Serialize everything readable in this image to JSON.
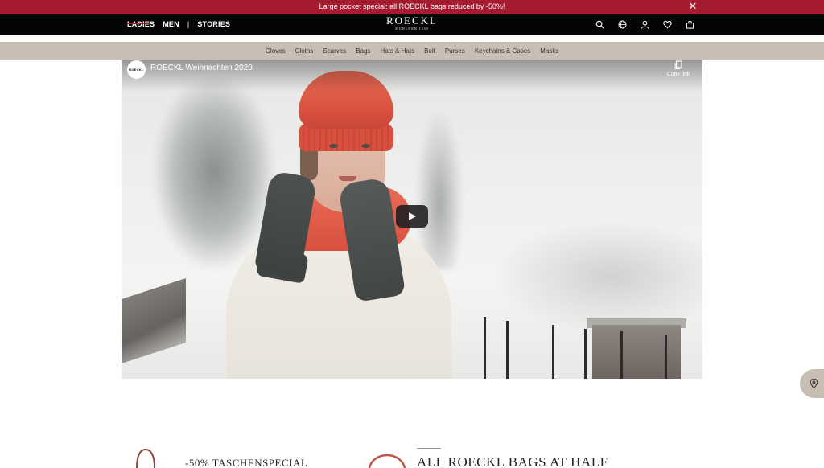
{
  "promo": {
    "text": "Large pocket special: all ROECKL bags reduced by -50%!",
    "close_icon": "close-icon"
  },
  "header": {
    "nav": [
      {
        "label": "LADIES"
      },
      {
        "label": "MEN"
      },
      {
        "label": "|"
      },
      {
        "label": "STORIES"
      }
    ],
    "logo": {
      "brand": "ROECKL",
      "sub": "MÜNCHEN 1839"
    },
    "icons": [
      "search-icon",
      "globe-icon",
      "account-icon",
      "wishlist-icon",
      "bag-icon"
    ]
  },
  "categories": [
    "Gloves",
    "Cloths",
    "Scarves",
    "Bags",
    "Hats & Hats",
    "Belt",
    "Purses",
    "Keychains & Cases",
    "Masks"
  ],
  "video": {
    "channel_avatar": "ROECKL",
    "title": "ROECKL Weihnachten 2020",
    "copy_label": "Copy link",
    "play_icon": "play-icon"
  },
  "sections": {
    "heading_1": "-50% TASCHENSPECIAL",
    "heading_2": "ALL ROECKL BAGS AT HALF"
  },
  "colors": {
    "brand_red": "#a51c30",
    "header_black": "#050505",
    "category_bar": "#c9beb3"
  }
}
